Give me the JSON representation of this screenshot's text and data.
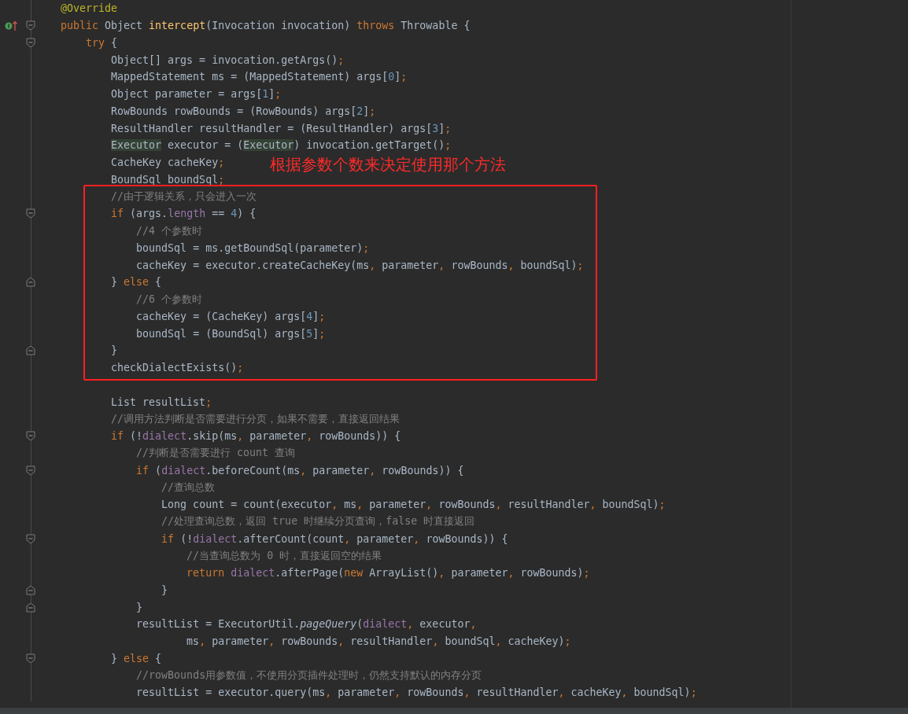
{
  "annotation": {
    "text": "根据参数个数来决定使用那个方法"
  },
  "lines": [
    {
      "kind": "code",
      "segs": [
        {
          "kind": "annotation",
          "text": "@Override"
        }
      ]
    },
    {
      "kind": "code",
      "gutter": [
        {
          "kind": "override"
        },
        {
          "kind": "fold_start"
        }
      ],
      "segs": [
        {
          "kind": "keyword",
          "text": "public "
        },
        {
          "kind": "plain",
          "text": "Object "
        },
        {
          "kind": "method",
          "text": "intercept"
        },
        {
          "kind": "plain",
          "text": "(Invocation invocation) "
        },
        {
          "kind": "keyword",
          "text": "throws "
        },
        {
          "kind": "plain",
          "text": "Throwable {"
        }
      ]
    },
    {
      "kind": "code",
      "gutter": [
        {
          "kind": "fold_start"
        }
      ],
      "segs": [
        {
          "kind": "keyword",
          "text": "    try "
        },
        {
          "kind": "plain",
          "text": "{"
        }
      ]
    },
    {
      "kind": "code",
      "segs": [
        {
          "kind": "plain",
          "text": "        Object[] args = invocation.getArgs()"
        },
        {
          "kind": "keyword",
          "text": ";"
        }
      ]
    },
    {
      "kind": "code",
      "segs": [
        {
          "kind": "plain",
          "text": "        MappedStatement ms = (MappedStatement) args["
        },
        {
          "kind": "number",
          "text": "0"
        },
        {
          "kind": "plain",
          "text": "]"
        },
        {
          "kind": "keyword",
          "text": ";"
        }
      ]
    },
    {
      "kind": "code",
      "segs": [
        {
          "kind": "plain",
          "text": "        Object parameter = args["
        },
        {
          "kind": "number",
          "text": "1"
        },
        {
          "kind": "plain",
          "text": "]"
        },
        {
          "kind": "keyword",
          "text": ";"
        }
      ]
    },
    {
      "kind": "code",
      "segs": [
        {
          "kind": "plain",
          "text": "        RowBounds rowBounds = (RowBounds) args["
        },
        {
          "kind": "number",
          "text": "2"
        },
        {
          "kind": "plain",
          "text": "]"
        },
        {
          "kind": "keyword",
          "text": ";"
        }
      ]
    },
    {
      "kind": "code",
      "segs": [
        {
          "kind": "plain",
          "text": "        ResultHandler resultHandler = (ResultHandler) args["
        },
        {
          "kind": "number",
          "text": "3"
        },
        {
          "kind": "plain",
          "text": "]"
        },
        {
          "kind": "keyword",
          "text": ";"
        }
      ]
    },
    {
      "kind": "code",
      "segs": [
        {
          "kind": "usage",
          "text": "        Executor"
        },
        {
          "kind": "plain",
          "text": " executor = ("
        },
        {
          "kind": "usage",
          "text": "Executor"
        },
        {
          "kind": "plain",
          "text": ") invocation.getTarget()"
        },
        {
          "kind": "keyword",
          "text": ";"
        }
      ]
    },
    {
      "kind": "code",
      "segs": [
        {
          "kind": "plain",
          "text": "        CacheKey cacheKey"
        },
        {
          "kind": "keyword",
          "text": ";"
        }
      ]
    },
    {
      "kind": "code",
      "segs": [
        {
          "kind": "plain",
          "text": "        BoundSql boundSql"
        },
        {
          "kind": "keyword",
          "text": ";"
        }
      ]
    },
    {
      "kind": "code",
      "segs": [
        {
          "kind": "comment",
          "text": "        //由于逻辑关系，只会进入一次"
        }
      ]
    },
    {
      "kind": "code",
      "gutter": [
        {
          "kind": "fold_start"
        }
      ],
      "segs": [
        {
          "kind": "keyword",
          "text": "        if "
        },
        {
          "kind": "plain",
          "text": "(args."
        },
        {
          "kind": "field",
          "text": "length"
        },
        {
          "kind": "plain",
          "text": " == "
        },
        {
          "kind": "number",
          "text": "4"
        },
        {
          "kind": "plain",
          "text": ") {"
        }
      ]
    },
    {
      "kind": "code",
      "segs": [
        {
          "kind": "comment",
          "text": "            //4 个参数时"
        }
      ]
    },
    {
      "kind": "code",
      "segs": [
        {
          "kind": "plain",
          "text": "            boundSql = ms.getBoundSql(parameter)"
        },
        {
          "kind": "keyword",
          "text": ";"
        }
      ]
    },
    {
      "kind": "code",
      "segs": [
        {
          "kind": "plain",
          "text": "            cacheKey = executor.createCacheKey(ms"
        },
        {
          "kind": "keyword",
          "text": ", "
        },
        {
          "kind": "plain",
          "text": "parameter"
        },
        {
          "kind": "keyword",
          "text": ", "
        },
        {
          "kind": "plain",
          "text": "rowBounds"
        },
        {
          "kind": "keyword",
          "text": ", "
        },
        {
          "kind": "plain",
          "text": "boundSql)"
        },
        {
          "kind": "keyword",
          "text": ";"
        }
      ]
    },
    {
      "kind": "code",
      "gutter": [
        {
          "kind": "fold_end"
        }
      ],
      "segs": [
        {
          "kind": "plain",
          "text": "        } "
        },
        {
          "kind": "keyword",
          "text": "else "
        },
        {
          "kind": "plain",
          "text": "{"
        }
      ]
    },
    {
      "kind": "code",
      "segs": [
        {
          "kind": "comment",
          "text": "            //6 个参数时"
        }
      ]
    },
    {
      "kind": "code",
      "segs": [
        {
          "kind": "plain",
          "text": "            cacheKey = (CacheKey) args["
        },
        {
          "kind": "number",
          "text": "4"
        },
        {
          "kind": "plain",
          "text": "]"
        },
        {
          "kind": "keyword",
          "text": ";"
        }
      ]
    },
    {
      "kind": "code",
      "segs": [
        {
          "kind": "plain",
          "text": "            boundSql = (BoundSql) args["
        },
        {
          "kind": "number",
          "text": "5"
        },
        {
          "kind": "plain",
          "text": "]"
        },
        {
          "kind": "keyword",
          "text": ";"
        }
      ]
    },
    {
      "kind": "code",
      "gutter": [
        {
          "kind": "fold_end"
        }
      ],
      "segs": [
        {
          "kind": "plain",
          "text": "        }"
        }
      ]
    },
    {
      "kind": "code",
      "segs": [
        {
          "kind": "plain",
          "text": "        checkDialectExists()"
        },
        {
          "kind": "keyword",
          "text": ";"
        }
      ]
    },
    {
      "kind": "blank"
    },
    {
      "kind": "code",
      "segs": [
        {
          "kind": "plain",
          "text": "        List resultList"
        },
        {
          "kind": "keyword",
          "text": ";"
        }
      ]
    },
    {
      "kind": "code",
      "segs": [
        {
          "kind": "comment",
          "text": "        //调用方法判断是否需要进行分页，如果不需要，直接返回结果"
        }
      ]
    },
    {
      "kind": "code",
      "gutter": [
        {
          "kind": "fold_start"
        }
      ],
      "segs": [
        {
          "kind": "keyword",
          "text": "        if "
        },
        {
          "kind": "plain",
          "text": "(!"
        },
        {
          "kind": "field",
          "text": "dialect"
        },
        {
          "kind": "plain",
          "text": ".skip(ms"
        },
        {
          "kind": "keyword",
          "text": ", "
        },
        {
          "kind": "plain",
          "text": "parameter"
        },
        {
          "kind": "keyword",
          "text": ", "
        },
        {
          "kind": "plain",
          "text": "rowBounds)) {"
        }
      ]
    },
    {
      "kind": "code",
      "segs": [
        {
          "kind": "comment",
          "text": "            //判断是否需要进行 count 查询"
        }
      ]
    },
    {
      "kind": "code",
      "gutter": [
        {
          "kind": "fold_start"
        }
      ],
      "segs": [
        {
          "kind": "keyword",
          "text": "            if "
        },
        {
          "kind": "plain",
          "text": "("
        },
        {
          "kind": "field",
          "text": "dialect"
        },
        {
          "kind": "plain",
          "text": ".beforeCount(ms"
        },
        {
          "kind": "keyword",
          "text": ", "
        },
        {
          "kind": "plain",
          "text": "parameter"
        },
        {
          "kind": "keyword",
          "text": ", "
        },
        {
          "kind": "plain",
          "text": "rowBounds)) {"
        }
      ]
    },
    {
      "kind": "code",
      "segs": [
        {
          "kind": "comment",
          "text": "                //查询总数"
        }
      ]
    },
    {
      "kind": "code",
      "segs": [
        {
          "kind": "plain",
          "text": "                Long count = count(executor"
        },
        {
          "kind": "keyword",
          "text": ", "
        },
        {
          "kind": "plain",
          "text": "ms"
        },
        {
          "kind": "keyword",
          "text": ", "
        },
        {
          "kind": "plain",
          "text": "parameter"
        },
        {
          "kind": "keyword",
          "text": ", "
        },
        {
          "kind": "plain",
          "text": "rowBounds"
        },
        {
          "kind": "keyword",
          "text": ", "
        },
        {
          "kind": "plain",
          "text": "resultHandler"
        },
        {
          "kind": "keyword",
          "text": ", "
        },
        {
          "kind": "plain",
          "text": "boundSql)"
        },
        {
          "kind": "keyword",
          "text": ";"
        }
      ]
    },
    {
      "kind": "code",
      "segs": [
        {
          "kind": "comment",
          "text": "                //处理查询总数，返回 true 时继续分页查询，false 时直接返回"
        }
      ]
    },
    {
      "kind": "code",
      "gutter": [
        {
          "kind": "fold_start"
        }
      ],
      "segs": [
        {
          "kind": "keyword",
          "text": "                if "
        },
        {
          "kind": "plain",
          "text": "(!"
        },
        {
          "kind": "field",
          "text": "dialect"
        },
        {
          "kind": "plain",
          "text": ".afterCount(count"
        },
        {
          "kind": "keyword",
          "text": ", "
        },
        {
          "kind": "plain",
          "text": "parameter"
        },
        {
          "kind": "keyword",
          "text": ", "
        },
        {
          "kind": "plain",
          "text": "rowBounds)) {"
        }
      ]
    },
    {
      "kind": "code",
      "segs": [
        {
          "kind": "comment",
          "text": "                    //当查询总数为 0 时，直接返回空的结果"
        }
      ]
    },
    {
      "kind": "code",
      "segs": [
        {
          "kind": "keyword",
          "text": "                    return "
        },
        {
          "kind": "field",
          "text": "dialect"
        },
        {
          "kind": "plain",
          "text": ".afterPage("
        },
        {
          "kind": "keyword",
          "text": "new "
        },
        {
          "kind": "plain",
          "text": "ArrayList()"
        },
        {
          "kind": "keyword",
          "text": ", "
        },
        {
          "kind": "plain",
          "text": "parameter"
        },
        {
          "kind": "keyword",
          "text": ", "
        },
        {
          "kind": "plain",
          "text": "rowBounds)"
        },
        {
          "kind": "keyword",
          "text": ";"
        }
      ]
    },
    {
      "kind": "code",
      "gutter": [
        {
          "kind": "fold_end"
        }
      ],
      "segs": [
        {
          "kind": "plain",
          "text": "                }"
        }
      ]
    },
    {
      "kind": "code",
      "gutter": [
        {
          "kind": "fold_end"
        }
      ],
      "segs": [
        {
          "kind": "plain",
          "text": "            }"
        }
      ]
    },
    {
      "kind": "code",
      "segs": [
        {
          "kind": "plain",
          "text": "            resultList = ExecutorUtil."
        },
        {
          "kind": "static",
          "text": "pageQuery"
        },
        {
          "kind": "plain",
          "text": "("
        },
        {
          "kind": "field",
          "text": "dialect"
        },
        {
          "kind": "keyword",
          "text": ", "
        },
        {
          "kind": "plain",
          "text": "executor"
        },
        {
          "kind": "keyword",
          "text": ","
        }
      ]
    },
    {
      "kind": "code",
      "segs": [
        {
          "kind": "plain",
          "text": "                    ms"
        },
        {
          "kind": "keyword",
          "text": ", "
        },
        {
          "kind": "plain",
          "text": "parameter"
        },
        {
          "kind": "keyword",
          "text": ", "
        },
        {
          "kind": "plain",
          "text": "rowBounds"
        },
        {
          "kind": "keyword",
          "text": ", "
        },
        {
          "kind": "plain",
          "text": "resultHandler"
        },
        {
          "kind": "keyword",
          "text": ", "
        },
        {
          "kind": "plain",
          "text": "boundSql"
        },
        {
          "kind": "keyword",
          "text": ", "
        },
        {
          "kind": "plain",
          "text": "cacheKey)"
        },
        {
          "kind": "keyword",
          "text": ";"
        }
      ]
    },
    {
      "kind": "code",
      "gutter": [
        {
          "kind": "fold_start"
        }
      ],
      "segs": [
        {
          "kind": "plain",
          "text": "        } "
        },
        {
          "kind": "keyword",
          "text": "else "
        },
        {
          "kind": "plain",
          "text": "{"
        }
      ]
    },
    {
      "kind": "code",
      "segs": [
        {
          "kind": "comment",
          "text": "            //rowBounds用参数值，不使用分页插件处理时，仍然支持默认的内存分页"
        }
      ]
    },
    {
      "kind": "code",
      "segs": [
        {
          "kind": "plain",
          "text": "            resultList = executor.query(ms"
        },
        {
          "kind": "keyword",
          "text": ", "
        },
        {
          "kind": "plain",
          "text": "parameter"
        },
        {
          "kind": "keyword",
          "text": ", "
        },
        {
          "kind": "plain",
          "text": "rowBounds"
        },
        {
          "kind": "keyword",
          "text": ", "
        },
        {
          "kind": "plain",
          "text": "resultHandler"
        },
        {
          "kind": "keyword",
          "text": ", "
        },
        {
          "kind": "plain",
          "text": "cacheKey"
        },
        {
          "kind": "keyword",
          "text": ", "
        },
        {
          "kind": "plain",
          "text": "boundSql)"
        },
        {
          "kind": "keyword",
          "text": ";"
        }
      ]
    }
  ]
}
